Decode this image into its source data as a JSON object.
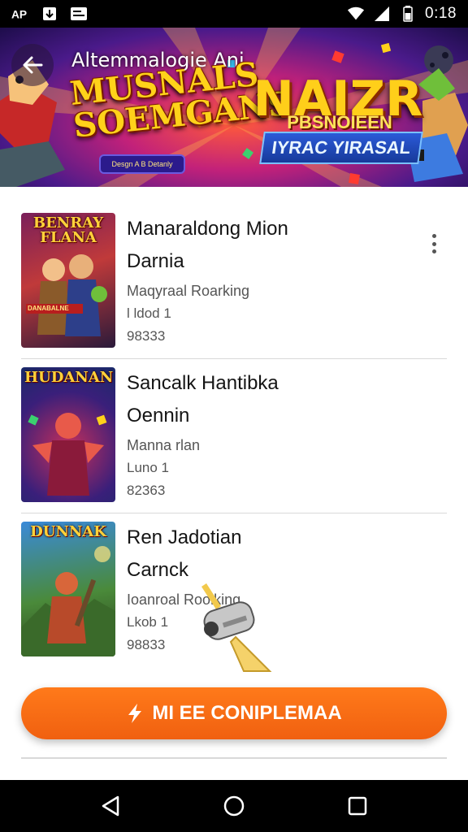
{
  "status_bar": {
    "time": "0:18",
    "icons": [
      "notification-icon",
      "download-icon",
      "media-icon",
      "wifi-icon",
      "signal-icon",
      "battery-icon"
    ]
  },
  "banner": {
    "top_text": "Altemmalogie Ani",
    "left_title": "MUSNALS SOEMGANS",
    "pill_text": "Desgn A B Detanly",
    "right_title": "NAIZR",
    "right_sub1": "PBSNOIEEN",
    "right_sub2": "IYRAC YIRASAL"
  },
  "games": [
    {
      "title_line1": "Manaraldong Mion",
      "title_line2": "Darnia",
      "subtitle": "Maqyraal Roarking",
      "meta1": "l ldod 1",
      "meta2": "98333",
      "thumb_text": "BENRAY FLANA",
      "thumb_badge": "DANABALNE"
    },
    {
      "title_line1": "Sancalk Hantibka",
      "title_line2": "Oennin",
      "subtitle": "Manna rlan",
      "meta1": "Luno 1",
      "meta2": "82363",
      "thumb_text": "HUDANAN",
      "thumb_badge": ""
    },
    {
      "title_line1": "Ren Jadotian",
      "title_line2": "Carnck",
      "subtitle": "Ioanroal Roolking",
      "meta1": "Lkob 1",
      "meta2": "98833",
      "thumb_text": "DUNNAK",
      "thumb_badge": ""
    }
  ],
  "cta": {
    "label": "MI EE CONIPLEMAA"
  },
  "colors": {
    "accent": "#f26b14",
    "banner": "#6a1a9a"
  }
}
